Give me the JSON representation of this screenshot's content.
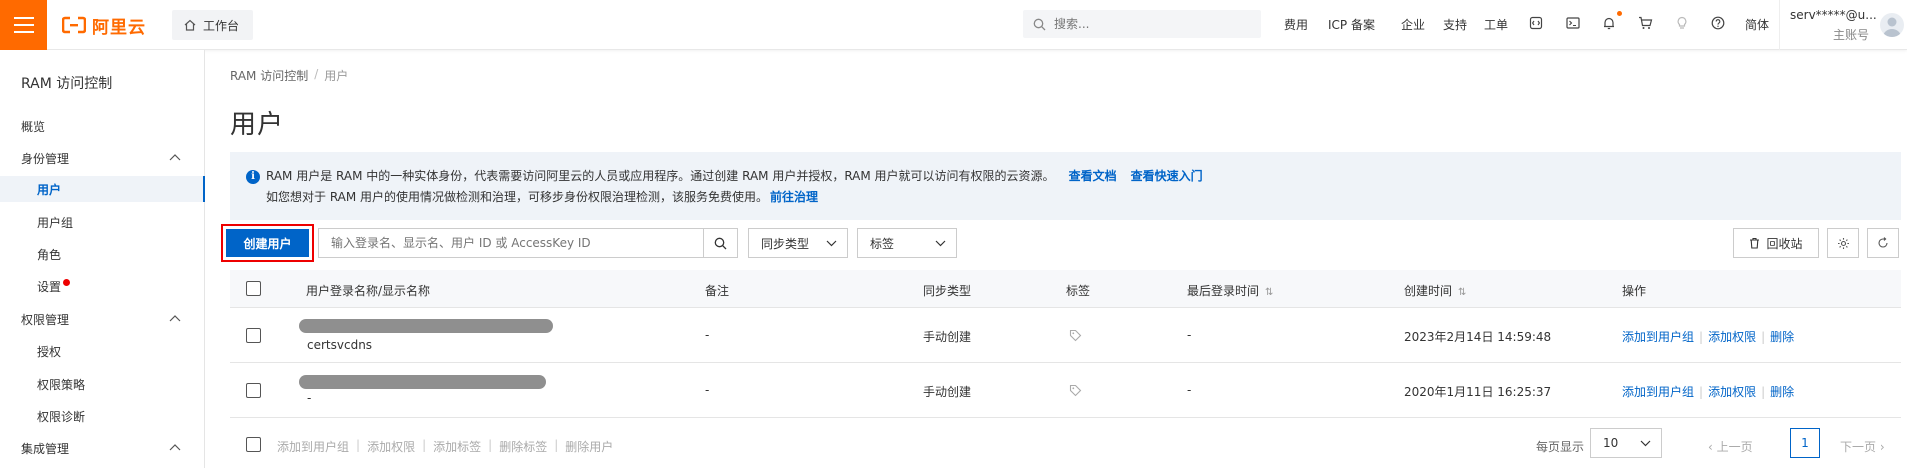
{
  "topbar": {
    "logo_text": "阿里云",
    "workbench_label": "工作台",
    "search_placeholder": "搜索...",
    "nav": {
      "fees": "费用",
      "icp": "ICP 备案",
      "enterprise": "企业",
      "support": "支持",
      "ticket": "工单",
      "language": "简体"
    },
    "account_name": "serv*****@u...",
    "account_type": "主账号",
    "brand_color": "#ff6a00"
  },
  "sidebar": {
    "title": "RAM 访问控制",
    "overview": "概览",
    "identity_group": "身份管理",
    "users": "用户",
    "user_groups": "用户组",
    "roles": "角色",
    "settings": "设置",
    "permission_group": "权限管理",
    "grants": "授权",
    "policies": "权限策略",
    "diagnosis": "权限诊断",
    "integration_group": "集成管理"
  },
  "breadcrumb": {
    "root": "RAM 访问控制",
    "separator": "/",
    "current": "用户"
  },
  "page_title": "用户",
  "info": {
    "line1": "RAM 用户是 RAM 中的一种实体身份，代表需要访问阿里云的人员或应用程序。通过创建 RAM 用户并授权，RAM 用户就可以访问有权限的云资源。",
    "link_docs": "查看文档",
    "link_quickstart": "查看快速入门",
    "line2": "如您想对于 RAM 用户的使用情况做检测和治理，可移步身份权限治理检测，该服务免费使用。",
    "link_governance": "前往治理"
  },
  "toolbar": {
    "create_label": "创建用户",
    "filter_placeholder": "输入登录名、显示名、用户 ID 或 AccessKey ID",
    "sync_type_label": "同步类型",
    "tags_label": "标签",
    "recycle_label": "回收站"
  },
  "table": {
    "columns": {
      "name": "用户登录名称/显示名称",
      "remark": "备注",
      "sync_type": "同步类型",
      "tags": "标签",
      "last_login": "最后登录时间",
      "created": "创建时间",
      "actions": "操作"
    },
    "rows": [
      {
        "display_name": "certsvcdns",
        "remark": "-",
        "sync_type": "手动创建",
        "last_login": "-",
        "created": "2023年2月14日 14:59:48"
      },
      {
        "display_name": "-",
        "remark": "-",
        "sync_type": "手动创建",
        "last_login": "-",
        "created": "2020年1月11日 16:25:37"
      }
    ],
    "actions": {
      "add_to_group": "添加到用户组",
      "add_permission": "添加权限",
      "delete": "删除",
      "separator": "|"
    }
  },
  "footer": {
    "bulk": {
      "add_to_group": "添加到用户组",
      "add_permission": "添加权限",
      "add_tags": "添加标签",
      "remove_tags": "删除标签",
      "delete_users": "删除用户",
      "separator": "|"
    },
    "page_size_label": "每页显示",
    "page_size": "10",
    "prev": "上一页",
    "current_page": "1",
    "next": "下一页"
  },
  "colors": {
    "primary": "#0064c8",
    "brand": "#ff6a00",
    "highlight_border": "#e00000",
    "info_bg": "#eff3f8"
  }
}
